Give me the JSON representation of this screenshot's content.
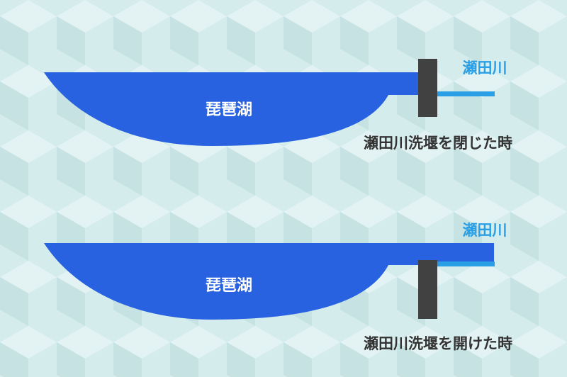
{
  "colors": {
    "background": "#d4ecec",
    "pattern_light": "#e3f3f3",
    "pattern_dark": "#c6e2e2",
    "lake": "#2962e0",
    "river": "#2b9fe6",
    "weir": "#414141",
    "caption": "#333333",
    "lake_label": "#ffffff"
  },
  "panels": [
    {
      "state": "closed",
      "lake_label": "琵琶湖",
      "river_label": "瀬田川",
      "caption": "瀬田川洗堰を閉じた時"
    },
    {
      "state": "open",
      "lake_label": "琵琶湖",
      "river_label": "瀬田川",
      "caption": "瀬田川洗堰を開けた時"
    }
  ]
}
